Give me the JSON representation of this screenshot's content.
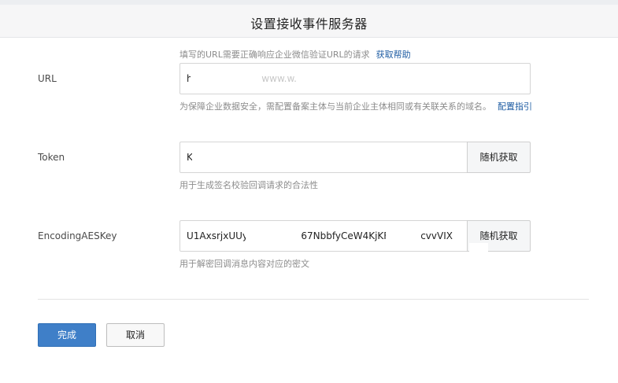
{
  "dialog": {
    "title": "设置接收事件服务器"
  },
  "url_row": {
    "label": "URL",
    "hint_top": "填写的URL需要正确响应企业微信验证URL的请求",
    "hint_top_link": "获取帮助",
    "value": "ht",
    "value_tail": "...ww.w.w.w...www.w.",
    "hint_bottom": "为保障企业数据安全，需配置备案主体与当前企业主体相同或有关联关系的域名。",
    "hint_bottom_link": "配置指引"
  },
  "token_row": {
    "label": "Token",
    "value": "K",
    "button_label": "随机获取",
    "hint": "用于生成签名校验回调请求的合法性"
  },
  "aes_row": {
    "label": "EncodingAESKey",
    "value": "U1AxsrjxUUyT",
    "value_mid": "67NbbfyCeW4KjKF",
    "value_tail": "cvvVIX",
    "button_label": "随机获取",
    "hint": "用于解密回调消息内容对应的密文"
  },
  "actions": {
    "confirm_label": "完成",
    "cancel_label": "取消"
  }
}
